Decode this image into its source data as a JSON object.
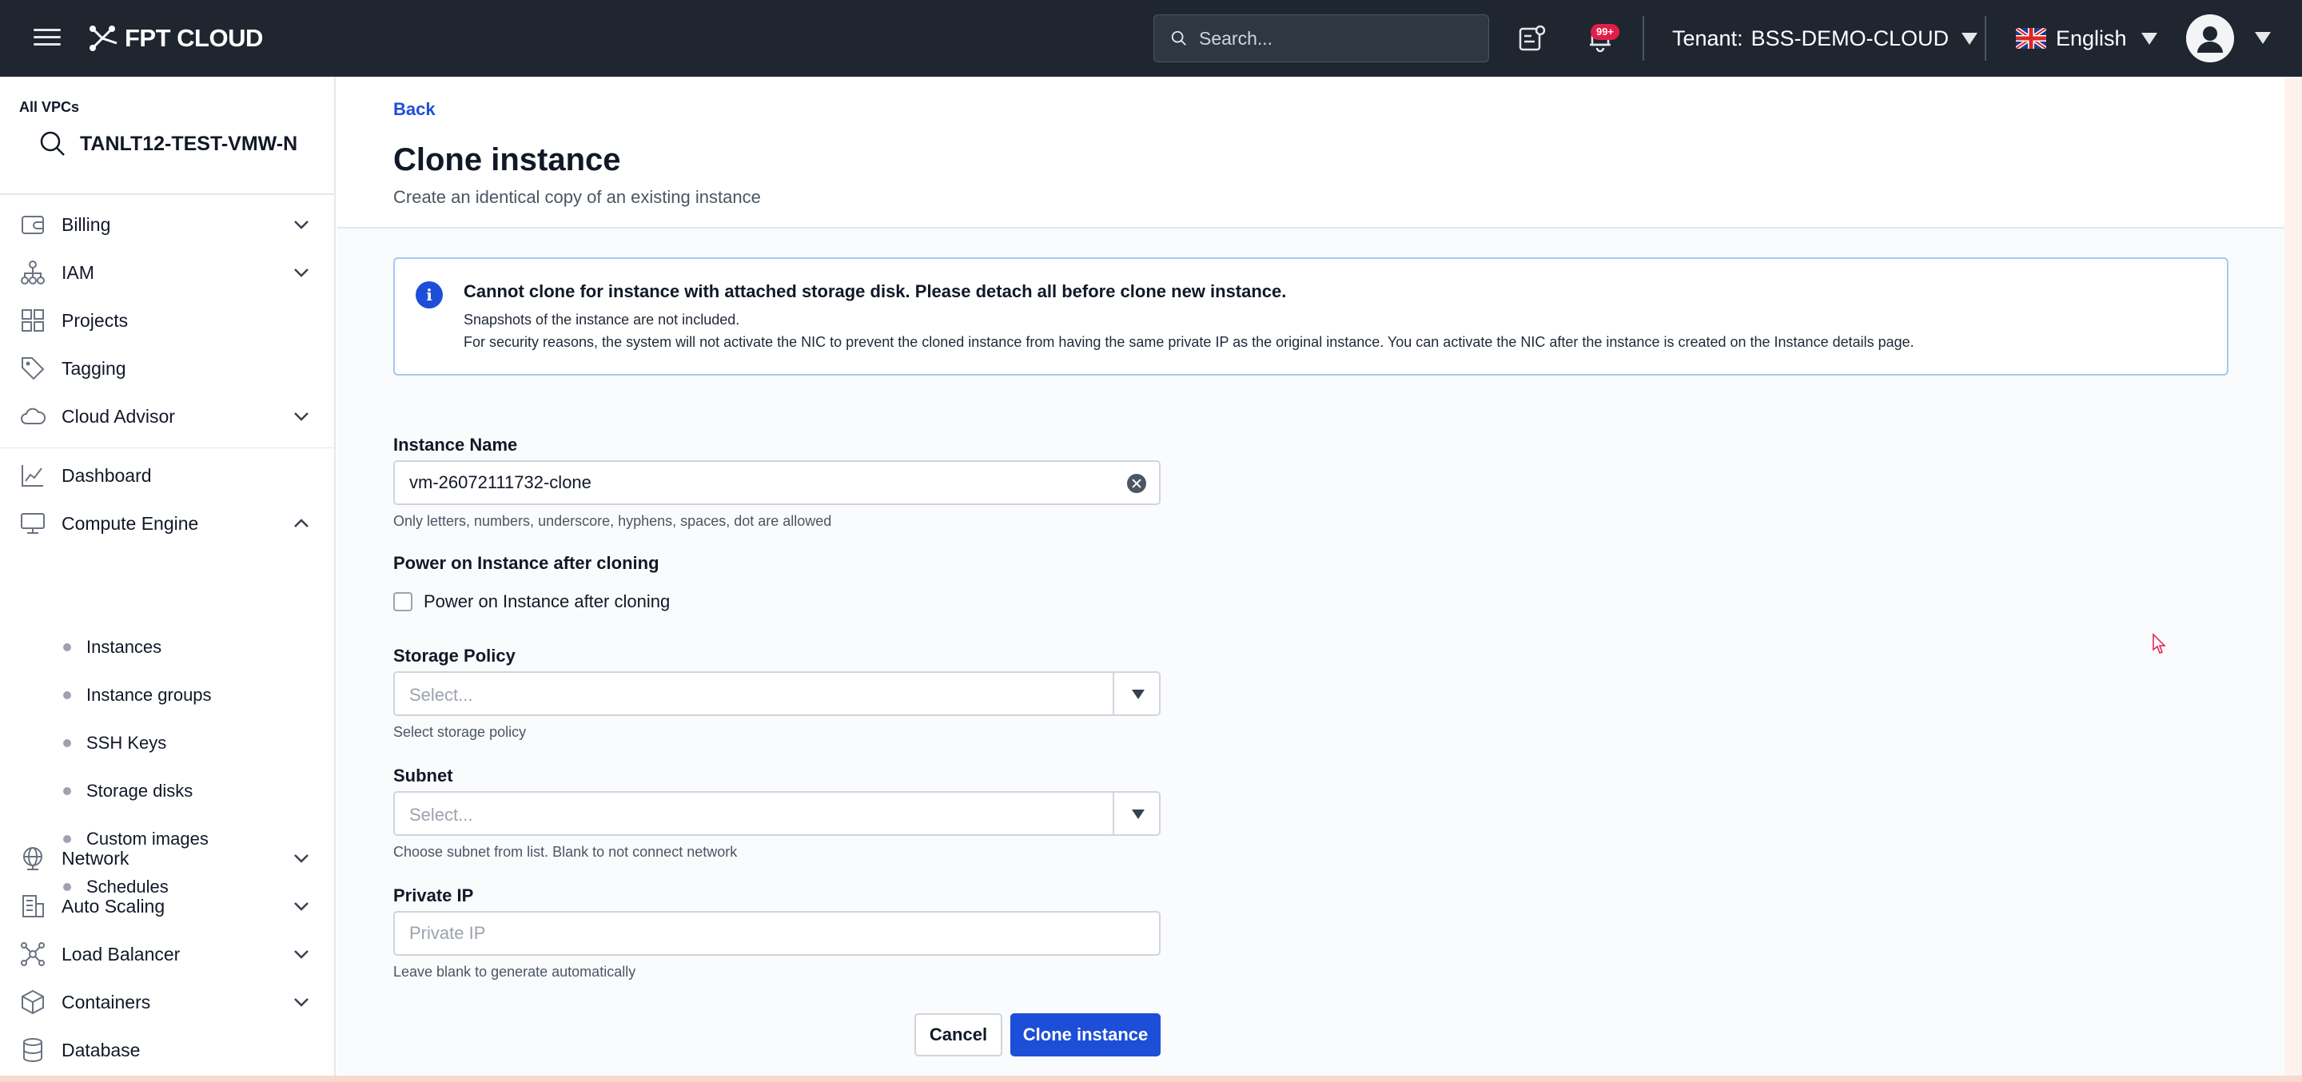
{
  "topbar": {
    "brand": "FPT CLOUD",
    "search_placeholder": "Search...",
    "notification_badge": "99+",
    "tenant_label": "Tenant:",
    "tenant_value": "BSS-DEMO-CLOUD",
    "language": "English"
  },
  "sidebar": {
    "vpc_label": "All VPCs",
    "vpc_name": "TANLT12-TEST-VMW-N",
    "items": [
      {
        "label": "Billing",
        "icon": "wallet-icon",
        "expandable": true
      },
      {
        "label": "IAM",
        "icon": "org-chart-icon",
        "expandable": true
      },
      {
        "label": "Projects",
        "icon": "grid-icon",
        "expandable": false
      },
      {
        "label": "Tagging",
        "icon": "tag-icon",
        "expandable": false
      },
      {
        "label": "Cloud Advisor",
        "icon": "cloud-icon",
        "expandable": true
      },
      {
        "label": "Dashboard",
        "icon": "chart-line-icon",
        "expandable": false
      },
      {
        "label": "Compute Engine",
        "icon": "monitor-icon",
        "expandable": true,
        "expanded": true
      },
      {
        "label": "Network",
        "icon": "globe-icon",
        "expandable": true
      },
      {
        "label": "Auto Scaling",
        "icon": "building-icon",
        "expandable": true
      },
      {
        "label": "Load Balancer",
        "icon": "nodes-icon",
        "expandable": true
      },
      {
        "label": "Containers",
        "icon": "cube-icon",
        "expandable": true
      },
      {
        "label": "Database",
        "icon": "database-icon",
        "expandable": false
      }
    ],
    "compute_sub_items": [
      "Instances",
      "Instance groups",
      "SSH Keys",
      "Storage disks",
      "Custom images",
      "Schedules"
    ]
  },
  "page": {
    "back": "Back",
    "title": "Clone instance",
    "subtitle": "Create an identical copy of an existing instance"
  },
  "info": {
    "title": "Cannot clone for instance with attached storage disk. Please detach all before clone new instance.",
    "line1": "Snapshots of the instance are not included.",
    "line2": "For security reasons, the system will not activate the NIC to prevent the cloned instance from having the same private IP as the original instance. You can activate the NIC after the instance is created on the Instance details page."
  },
  "form": {
    "instance_name_label": "Instance Name",
    "instance_name_value": "vm-26072111732-clone",
    "instance_name_hint": "Only letters, numbers, underscore, hyphens, spaces, dot are allowed",
    "power_label": "Power on Instance after cloning",
    "power_checkbox_label": "Power on Instance after cloning",
    "power_checked": false,
    "storage_policy_label": "Storage Policy",
    "storage_policy_placeholder": "Select...",
    "storage_policy_hint": "Select storage policy",
    "subnet_label": "Subnet",
    "subnet_placeholder": "Select...",
    "subnet_hint": "Choose subnet from list. Blank to not connect network",
    "private_ip_label": "Private IP",
    "private_ip_placeholder": "Private IP",
    "private_ip_hint": "Leave blank to generate automatically",
    "cancel_label": "Cancel",
    "submit_label": "Clone instance"
  },
  "colors": {
    "topbar_bg": "#1f2630",
    "primary": "#1d4ed8",
    "badge": "#e11d48",
    "info_border": "#a5c8ef"
  }
}
